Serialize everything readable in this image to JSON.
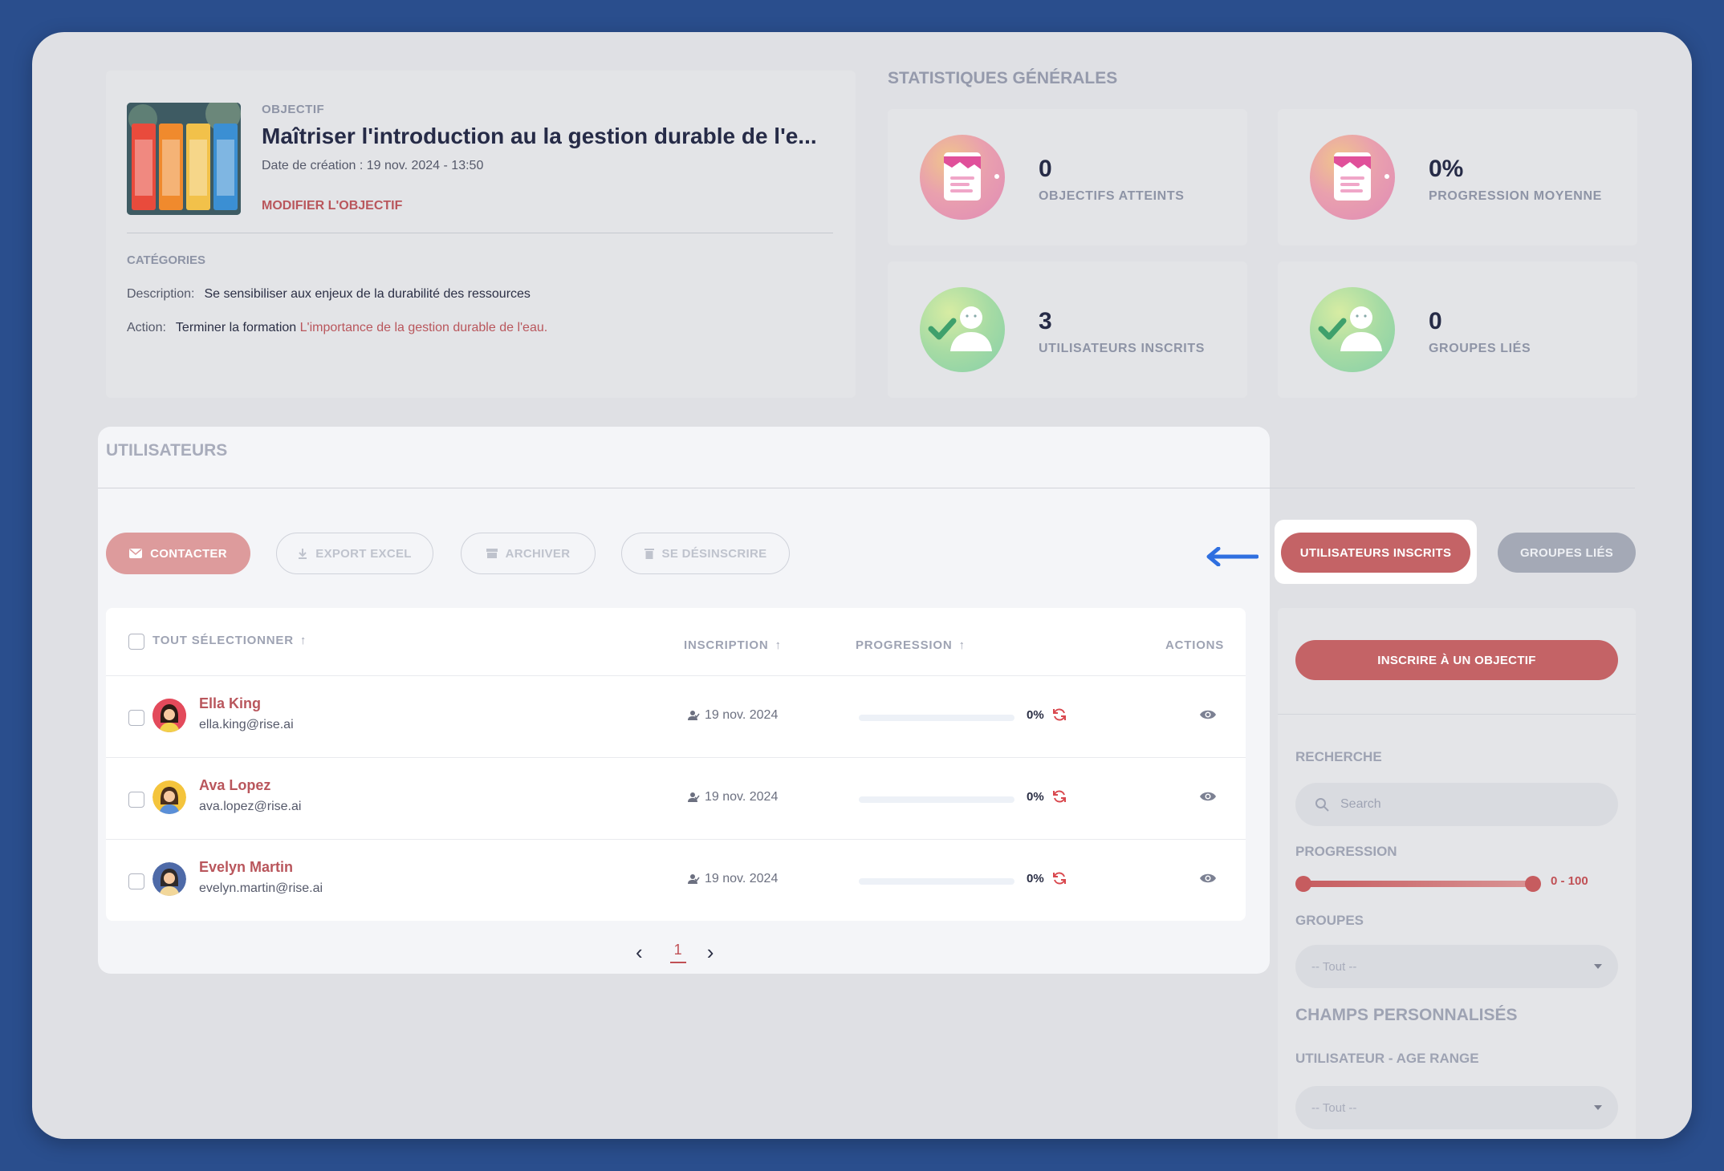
{
  "objective": {
    "eyebrow": "OBJECTIF",
    "title": "Maîtriser l'introduction au la gestion durable de l'e...",
    "date": "Date de création : 19 nov. 2024 - 13:50",
    "edit_label": "MODIFIER L'OBJECTIF",
    "categories_title": "CATÉGORIES",
    "description_label": "Description:",
    "description_value": "Se sensibiliser aux enjeux de la durabilité des ressources",
    "action_label": "Action:",
    "action_value": "Terminer la formation",
    "action_link": "L'importance de la gestion durable de l'eau."
  },
  "stats": {
    "title": "STATISTIQUES GÉNÉRALES",
    "items": [
      {
        "value": "0",
        "label": "OBJECTIFS ATTEINTS",
        "icon": "clipboard-icon"
      },
      {
        "value": "0%",
        "label": "PROGRESSION MOYENNE",
        "icon": "clipboard-icon"
      },
      {
        "value": "3",
        "label": "UTILISATEURS INSCRITS",
        "icon": "user-check-icon"
      },
      {
        "value": "0",
        "label": "GROUPES LIÉS",
        "icon": "user-check-icon"
      }
    ]
  },
  "users": {
    "title": "UTILISATEURS",
    "actions": {
      "contact": "CONTACTER",
      "export": "EXPORT EXCEL",
      "archive": "ARCHIVER",
      "unsubscribe": "SE DÉSINSCRIRE"
    },
    "tabs": {
      "enrolled": "UTILISATEURS INSCRITS",
      "groups": "GROUPES LIÉS"
    },
    "columns": {
      "select_all": "TOUT SÉLECTIONNER",
      "inscription": "INSCRIPTION",
      "progression": "PROGRESSION",
      "actions": "ACTIONS"
    },
    "rows": [
      {
        "name": "Ella King",
        "email": "ella.king@rise.ai",
        "date": "19 nov. 2024",
        "progress": 0,
        "progress_label": "0%"
      },
      {
        "name": "Ava Lopez",
        "email": "ava.lopez@rise.ai",
        "date": "19 nov. 2024",
        "progress": 0,
        "progress_label": "0%"
      },
      {
        "name": "Evelyn Martin",
        "email": "evelyn.martin@rise.ai",
        "date": "19 nov. 2024",
        "progress": 0,
        "progress_label": "0%"
      }
    ],
    "pagination": {
      "current": "1"
    }
  },
  "sidebar": {
    "enroll_button": "INSCRIRE À UN OBJECTIF",
    "search_label": "RECHERCHE",
    "search_placeholder": "Search",
    "progression_label": "PROGRESSION",
    "progression_range": "0 - 100",
    "groups_label": "GROUPES",
    "groups_value": "-- Tout --",
    "custom_fields_title": "CHAMPS PERSONNALISÉS",
    "age_range_label": "UTILISATEUR - AGE RANGE",
    "age_range_value": "-- Tout --"
  },
  "colors": {
    "accent": "#c46366",
    "link": "#b9565c",
    "background": "#2a4e8d",
    "annotation_arrow": "#2f6fe0"
  }
}
